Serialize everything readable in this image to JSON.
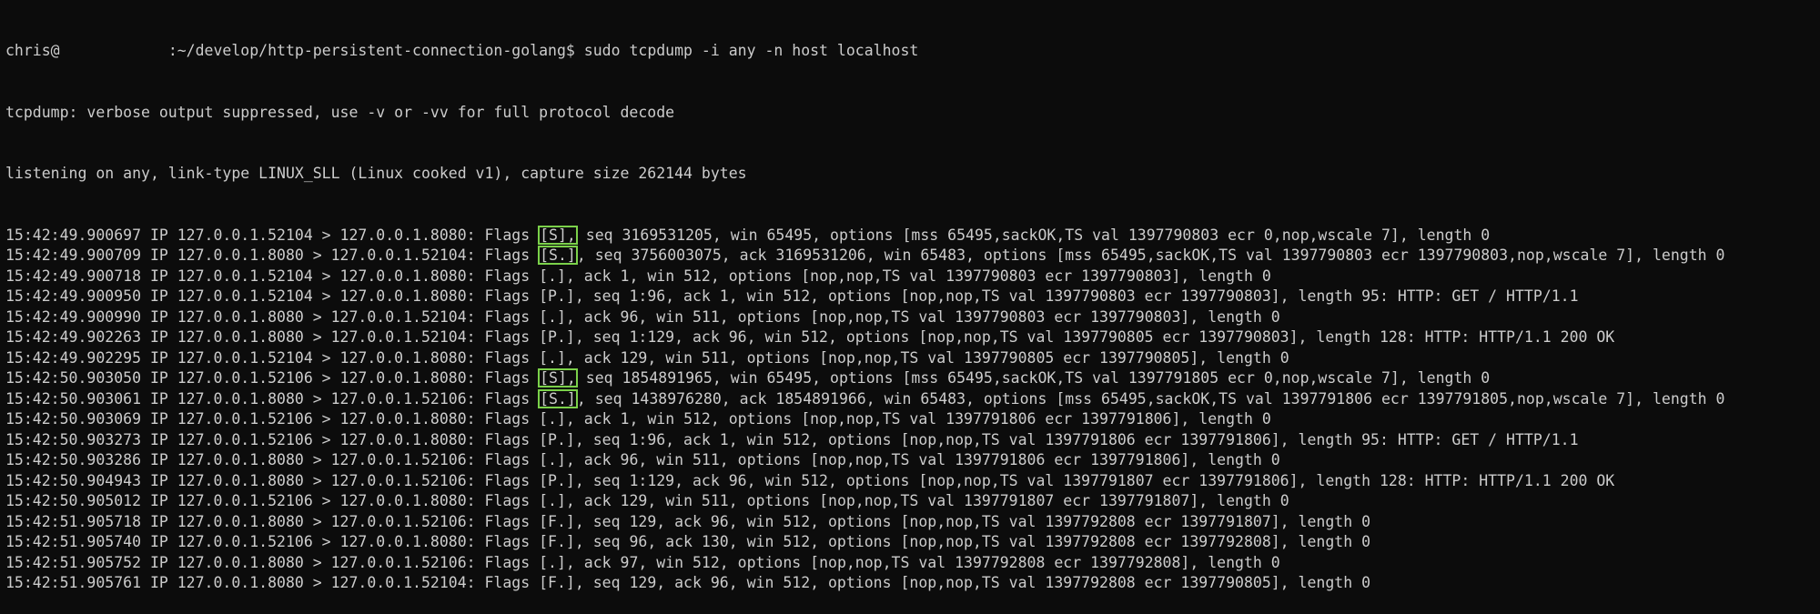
{
  "terminal": {
    "prompt": {
      "user": "chris@",
      "path": "            :~/develop/http-persistent-connection-golang$",
      "command": " sudo tcpdump -i any -n host localhost"
    },
    "header_lines": [
      "tcpdump: verbose output suppressed, use -v or -vv for full protocol decode",
      "listening on any, link-type LINUX_SLL (Linux cooked v1), capture size 262144 bytes"
    ],
    "packets": [
      {
        "pre": "15:42:49.900697 IP 127.0.0.1.52104 > 127.0.0.1.8080: Flags ",
        "flag": "[S],",
        "post": " seq 3169531205, win 65495, options [mss 65495,sackOK,TS val 1397790803 ecr 0,nop,wscale 7], length 0",
        "highlight": true
      },
      {
        "pre": "15:42:49.900709 IP 127.0.0.1.8080 > 127.0.0.1.52104: Flags ",
        "flag": "[S.]",
        "post": ", seq 3756003075, ack 3169531206, win 65483, options [mss 65495,sackOK,TS val 1397790803 ecr 1397790803,nop,wscale 7], length 0",
        "highlight": true
      },
      {
        "pre": "15:42:49.900718 IP 127.0.0.1.52104 > 127.0.0.1.8080: Flags ",
        "flag": "[.],",
        "post": " ack 1, win 512, options [nop,nop,TS val 1397790803 ecr 1397790803], length 0",
        "highlight": false
      },
      {
        "pre": "15:42:49.900950 IP 127.0.0.1.52104 > 127.0.0.1.8080: Flags ",
        "flag": "[P.],",
        "post": " seq 1:96, ack 1, win 512, options [nop,nop,TS val 1397790803 ecr 1397790803], length 95: HTTP: GET / HTTP/1.1",
        "highlight": false
      },
      {
        "pre": "15:42:49.900990 IP 127.0.0.1.8080 > 127.0.0.1.52104: Flags ",
        "flag": "[.],",
        "post": " ack 96, win 511, options [nop,nop,TS val 1397790803 ecr 1397790803], length 0",
        "highlight": false
      },
      {
        "pre": "15:42:49.902263 IP 127.0.0.1.8080 > 127.0.0.1.52104: Flags ",
        "flag": "[P.],",
        "post": " seq 1:129, ack 96, win 512, options [nop,nop,TS val 1397790805 ecr 1397790803], length 128: HTTP: HTTP/1.1 200 OK",
        "highlight": false
      },
      {
        "pre": "15:42:49.902295 IP 127.0.0.1.52104 > 127.0.0.1.8080: Flags ",
        "flag": "[.],",
        "post": " ack 129, win 511, options [nop,nop,TS val 1397790805 ecr 1397790805], length 0",
        "highlight": false
      },
      {
        "pre": "15:42:50.903050 IP 127.0.0.1.52106 > 127.0.0.1.8080: Flags ",
        "flag": "[S],",
        "post": " seq 1854891965, win 65495, options [mss 65495,sackOK,TS val 1397791805 ecr 0,nop,wscale 7], length 0",
        "highlight": true
      },
      {
        "pre": "15:42:50.903061 IP 127.0.0.1.8080 > 127.0.0.1.52106: Flags ",
        "flag": "[S.]",
        "post": ", seq 1438976280, ack 1854891966, win 65483, options [mss 65495,sackOK,TS val 1397791806 ecr 1397791805,nop,wscale 7], length 0",
        "highlight": true
      },
      {
        "pre": "15:42:50.903069 IP 127.0.0.1.52106 > 127.0.0.1.8080: Flags ",
        "flag": "[.],",
        "post": " ack 1, win 512, options [nop,nop,TS val 1397791806 ecr 1397791806], length 0",
        "highlight": false
      },
      {
        "pre": "15:42:50.903273 IP 127.0.0.1.52106 > 127.0.0.1.8080: Flags ",
        "flag": "[P.],",
        "post": " seq 1:96, ack 1, win 512, options [nop,nop,TS val 1397791806 ecr 1397791806], length 95: HTTP: GET / HTTP/1.1",
        "highlight": false
      },
      {
        "pre": "15:42:50.903286 IP 127.0.0.1.8080 > 127.0.0.1.52106: Flags ",
        "flag": "[.],",
        "post": " ack 96, win 511, options [nop,nop,TS val 1397791806 ecr 1397791806], length 0",
        "highlight": false
      },
      {
        "pre": "15:42:50.904943 IP 127.0.0.1.8080 > 127.0.0.1.52106: Flags ",
        "flag": "[P.],",
        "post": " seq 1:129, ack 96, win 512, options [nop,nop,TS val 1397791807 ecr 1397791806], length 128: HTTP: HTTP/1.1 200 OK",
        "highlight": false
      },
      {
        "pre": "15:42:50.905012 IP 127.0.0.1.52106 > 127.0.0.1.8080: Flags ",
        "flag": "[.],",
        "post": " ack 129, win 511, options [nop,nop,TS val 1397791807 ecr 1397791807], length 0",
        "highlight": false
      },
      {
        "pre": "15:42:51.905718 IP 127.0.0.1.8080 > 127.0.0.1.52106: Flags ",
        "flag": "[F.],",
        "post": " seq 129, ack 96, win 512, options [nop,nop,TS val 1397792808 ecr 1397791807], length 0",
        "highlight": false
      },
      {
        "pre": "15:42:51.905740 IP 127.0.0.1.52106 > 127.0.0.1.8080: Flags ",
        "flag": "[F.],",
        "post": " seq 96, ack 130, win 512, options [nop,nop,TS val 1397792808 ecr 1397792808], length 0",
        "highlight": false
      },
      {
        "pre": "15:42:51.905752 IP 127.0.0.1.8080 > 127.0.0.1.52106: Flags ",
        "flag": "[.],",
        "post": " ack 97, win 512, options [nop,nop,TS val 1397792808 ecr 1397792808], length 0",
        "highlight": false
      },
      {
        "pre": "15:42:51.905761 IP 127.0.0.1.8080 > 127.0.0.1.52104: Flags ",
        "flag": "[F.],",
        "post": " seq 129, ack 96, win 512, options [nop,nop,TS val 1397792808 ecr 1397790805], length 0",
        "highlight": false
      }
    ]
  },
  "colors": {
    "background": "#0c0c0c",
    "text": "#cccccc",
    "highlight_box": "#7bd14a"
  }
}
